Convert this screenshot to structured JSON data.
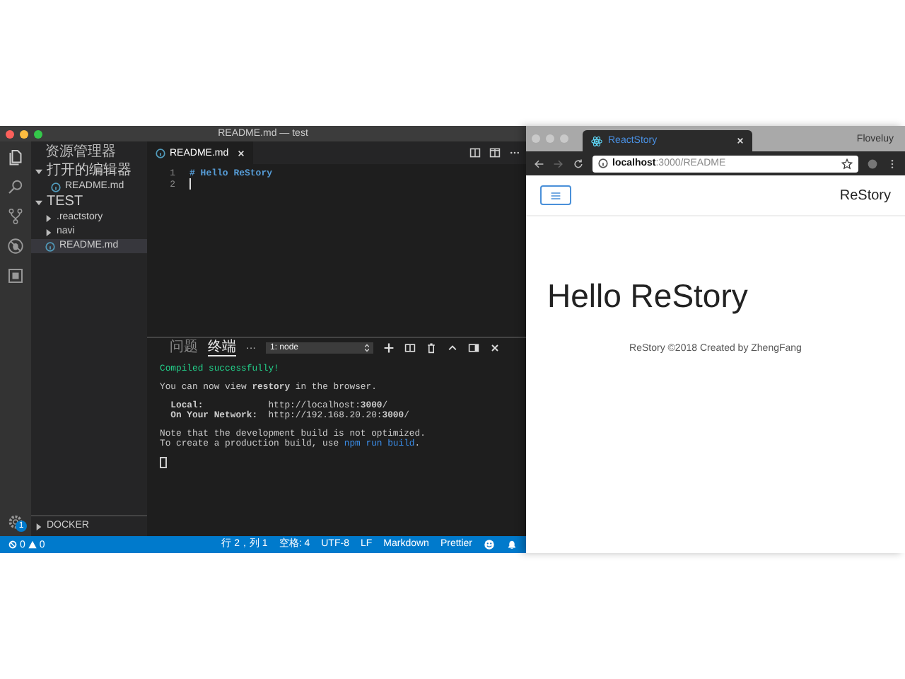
{
  "editor_window": {
    "title": "README.md — test",
    "activity_bar": {
      "badge": "1"
    },
    "sidebar": {
      "title": "资源管理器",
      "sections": [
        {
          "label": "打开的编辑器",
          "expanded": true,
          "children": [
            {
              "label": "README.md",
              "kind": "file",
              "selected": false
            }
          ]
        },
        {
          "label": "TEST",
          "expanded": true,
          "children": [
            {
              "label": ".reactstory",
              "kind": "folder",
              "selected": false
            },
            {
              "label": "navi",
              "kind": "folder",
              "selected": false
            },
            {
              "label": "README.md",
              "kind": "file",
              "selected": true
            }
          ]
        },
        {
          "label": "DOCKER",
          "expanded": false
        }
      ]
    },
    "tabs": [
      {
        "label": "README.md",
        "selected": true
      }
    ],
    "code_lines": [
      {
        "number": "1",
        "text": "# Hello ReStory"
      },
      {
        "number": "2"
      }
    ],
    "panel": {
      "tabs": [
        {
          "label": "问题",
          "selected": false
        },
        {
          "label": "终端",
          "selected": true
        }
      ],
      "more": "···",
      "terminal_select": "1: node",
      "output": [
        {
          "kind": "success",
          "parts": [
            {
              "kind": "plain",
              "text": "Compiled successfully!"
            }
          ]
        },
        {
          "kind": "blank"
        },
        {
          "kind": "plain",
          "parts": [
            {
              "kind": "plain",
              "text": "You can now view **restory** in the browser."
            }
          ]
        },
        {
          "kind": "blank"
        },
        {
          "kind": "plain",
          "parts": [
            {
              "kind": "plain",
              "text": "  **Local:**            http://localhost:**3000**/"
            }
          ]
        },
        {
          "kind": "plain",
          "parts": [
            {
              "kind": "plain",
              "text": "  **On Your Network:**  http://192.168.20.20:**3000**/"
            }
          ]
        },
        {
          "kind": "blank"
        },
        {
          "kind": "plain",
          "parts": [
            {
              "kind": "plain",
              "text": "Note that the development build is not optimized."
            }
          ]
        },
        {
          "kind": "plain",
          "parts": [
            {
              "kind": "plain",
              "text": "To create a production build, use "
            },
            {
              "kind": "command",
              "text": "npm run build"
            },
            {
              "kind": "plain",
              "text": "."
            }
          ]
        }
      ]
    },
    "status_bar": {
      "errors": "0",
      "warnings": "0",
      "items": [
        "行 2，列 1",
        "空格: 4",
        "UTF-8",
        "LF",
        "Markdown",
        "Prettier"
      ]
    }
  },
  "browser_window": {
    "profile": "Floveluy",
    "tab": {
      "label": "ReactStory"
    },
    "address": {
      "host": "localhost",
      "path": ":3000/README"
    },
    "page": {
      "brand": "ReStory",
      "heading": "Hello ReStory",
      "footer": "ReStory ©2018 Created by ZhengFang"
    }
  }
}
